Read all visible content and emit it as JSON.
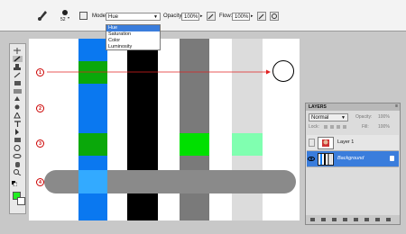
{
  "options_bar": {
    "brush_size": "52",
    "mode_label": "Mode:",
    "mode_value": "Hue",
    "opacity_label": "Opacity:",
    "opacity_value": "100%",
    "flow_label": "Flow:",
    "flow_value": "100%"
  },
  "mode_dropdown": {
    "options": [
      "Hue",
      "Saturation",
      "Color",
      "Luminosity"
    ],
    "selected": "Hue"
  },
  "canvas": {
    "markers": [
      "1",
      "2",
      "3",
      "4"
    ],
    "colors": {
      "blue": "#0a78f0",
      "green": "#0aa80a",
      "black": "#000000",
      "gray": "#7a7a7a",
      "bright_green": "#00e000",
      "light_gray": "#dcdcdc",
      "mint": "#80ffb0",
      "bar_gray": "#8a8a8a",
      "arrow_red": "#e02020"
    }
  },
  "toolbox": {
    "foreground_color": "#000000",
    "background_color": "#ffffff",
    "swatch_color": "#22ee22"
  },
  "layers_panel": {
    "title": "LAYERS",
    "blend_mode": "Normal",
    "opacity_label": "Opacity:",
    "opacity_value": "100%",
    "lock_label": "Lock:",
    "fill_label": "Fill:",
    "fill_value": "100%",
    "layers": [
      {
        "name": "Layer 1",
        "selected": false
      },
      {
        "name": "Background",
        "selected": true
      }
    ]
  }
}
